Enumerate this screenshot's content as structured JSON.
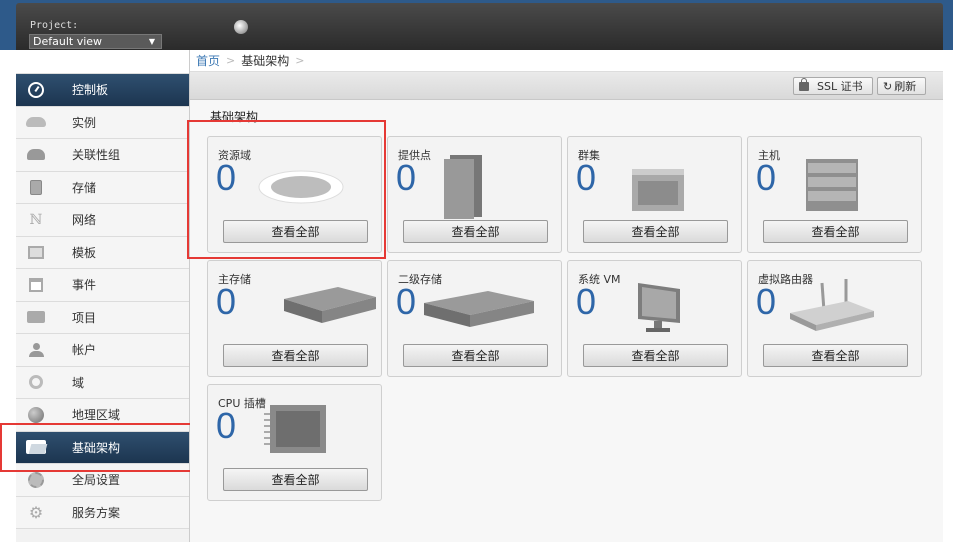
{
  "header": {
    "project_label": "Project:",
    "project_value": "Default view"
  },
  "breadcrumb": {
    "home": "首页",
    "separator": ">",
    "current": "基础架构"
  },
  "toolbar": {
    "ssl_label": "SSL 证书",
    "refresh_label": "刷新"
  },
  "sidebar": {
    "items": [
      {
        "label": "控制板",
        "icon": "dashboard-icon",
        "active": true
      },
      {
        "label": "实例",
        "icon": "cloud-icon",
        "active": false
      },
      {
        "label": "关联性组",
        "icon": "affinity-cloud-icon",
        "active": false
      },
      {
        "label": "存储",
        "icon": "storage-icon",
        "active": false
      },
      {
        "label": "网络",
        "icon": "network-icon",
        "active": false
      },
      {
        "label": "模板",
        "icon": "template-icon",
        "active": false
      },
      {
        "label": "事件",
        "icon": "calendar-icon",
        "active": false
      },
      {
        "label": "项目",
        "icon": "folder-icon",
        "active": false
      },
      {
        "label": "帐户",
        "icon": "user-icon",
        "active": false
      },
      {
        "label": "域",
        "icon": "domain-icon",
        "active": false
      },
      {
        "label": "地理区域",
        "icon": "globe-icon",
        "active": false
      },
      {
        "label": "基础架构",
        "icon": "infrastructure-icon",
        "active": true
      },
      {
        "label": "全局设置",
        "icon": "global-settings-icon",
        "active": false
      },
      {
        "label": "服务方案",
        "icon": "cog-icon",
        "active": false
      }
    ]
  },
  "main": {
    "section_title": "基础架构",
    "view_all_label": "查看全部",
    "cards": [
      {
        "label": "资源域",
        "count": "0",
        "icon": "zone-icon"
      },
      {
        "label": "提供点",
        "count": "0",
        "icon": "pod-icon"
      },
      {
        "label": "群集",
        "count": "0",
        "icon": "cluster-icon"
      },
      {
        "label": "主机",
        "count": "0",
        "icon": "host-icon"
      },
      {
        "label": "主存储",
        "count": "0",
        "icon": "primary-storage-icon"
      },
      {
        "label": "二级存储",
        "count": "0",
        "icon": "secondary-storage-icon"
      },
      {
        "label": "系统 VM",
        "count": "0",
        "icon": "system-vm-icon"
      },
      {
        "label": "虚拟路由器",
        "count": "0",
        "icon": "router-icon"
      },
      {
        "label": "CPU 插槽",
        "count": "0",
        "icon": "cpu-socket-icon"
      }
    ]
  },
  "colors": {
    "accent_blue": "#2e66a8",
    "active_nav": "#1c3550",
    "highlight_red": "#e53935"
  }
}
